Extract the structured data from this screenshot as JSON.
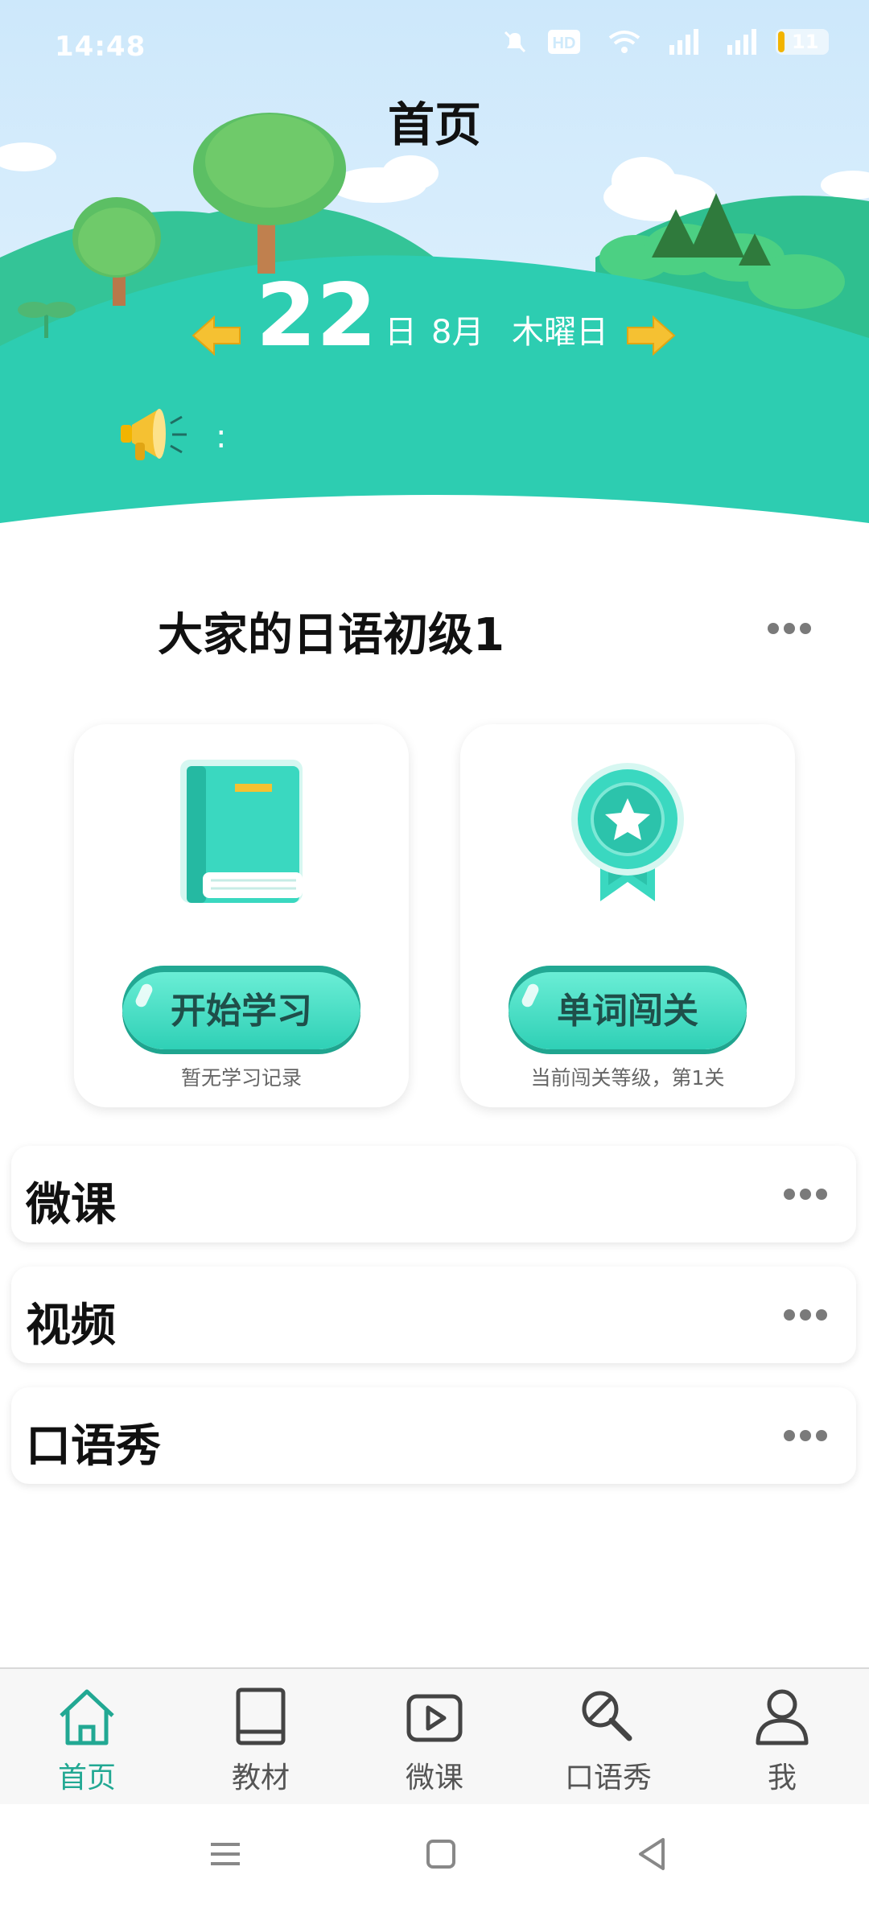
{
  "status_bar": {
    "time": "14:48",
    "battery": "11"
  },
  "header": {
    "title": "首页"
  },
  "date": {
    "day": "22",
    "day_unit": "日",
    "month": "8月",
    "weekday": "木曜日"
  },
  "notice": {
    "colon": ":"
  },
  "course": {
    "title": "大家的日语初级1"
  },
  "cards": [
    {
      "button": "开始学习",
      "subtitle": "暂无学习记录"
    },
    {
      "button": "单词闯关",
      "subtitle": "当前闯关等级，第1关"
    }
  ],
  "sections": [
    {
      "label": "微课"
    },
    {
      "label": "视频"
    },
    {
      "label": "口语秀"
    }
  ],
  "tabs": [
    {
      "label": "首页",
      "icon": "home-icon",
      "active": true
    },
    {
      "label": "教材",
      "icon": "book-icon",
      "active": false
    },
    {
      "label": "微课",
      "icon": "play-icon",
      "active": false
    },
    {
      "label": "口语秀",
      "icon": "microphone-icon",
      "active": false
    },
    {
      "label": "我",
      "icon": "person-icon",
      "active": false
    }
  ],
  "colors": {
    "accent": "#22a893",
    "hill": "#2fcdb0",
    "sky": "#cfeafb"
  }
}
